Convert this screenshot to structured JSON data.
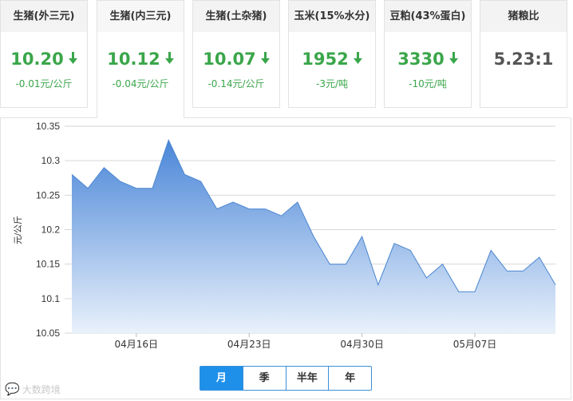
{
  "cards": [
    {
      "title": "生猪(外三元)",
      "price": "10.20",
      "change": "-0.01元/公斤",
      "trend": "down",
      "active": false
    },
    {
      "title": "生猪(内三元)",
      "price": "10.12",
      "change": "-0.04元/公斤",
      "trend": "down",
      "active": true
    },
    {
      "title": "生猪(土杂猪)",
      "price": "10.07",
      "change": "-0.14元/公斤",
      "trend": "down",
      "active": false
    },
    {
      "title": "玉米(15%水分)",
      "price": "1952",
      "change": "-3元/吨",
      "trend": "down",
      "active": false
    },
    {
      "title": "豆粕(43%蛋白)",
      "price": "3330",
      "change": "-10元/吨",
      "trend": "down",
      "active": false
    },
    {
      "title": "猪粮比",
      "price": "5.23:1",
      "change": "",
      "trend": "none",
      "active": false
    }
  ],
  "colors": {
    "down": "#3aa64a",
    "line": "#4a86cf",
    "area_top": "#4a86d8",
    "area_bottom": "#e9f1fb",
    "accent": "#1e90ea"
  },
  "chart_data": {
    "type": "area",
    "title": "",
    "xlabel": "",
    "ylabel": "元/公斤",
    "ylim": [
      10.05,
      10.35
    ],
    "yticks": [
      10.05,
      10.1,
      10.15,
      10.2,
      10.25,
      10.3,
      10.35
    ],
    "ytick_labels": [
      "10.05",
      "10.1",
      "10.15",
      "10.2",
      "10.25",
      "10.3",
      "10.35"
    ],
    "x": [
      "04-12",
      "04-13",
      "04-14",
      "04-15",
      "04-16",
      "04-17",
      "04-18",
      "04-19",
      "04-20",
      "04-21",
      "04-22",
      "04-23",
      "04-24",
      "04-25",
      "04-26",
      "04-27",
      "04-28",
      "04-29",
      "04-30",
      "05-01",
      "05-02",
      "05-03",
      "05-04",
      "05-05",
      "05-06",
      "05-07",
      "05-08",
      "05-09",
      "05-10",
      "05-11",
      "05-12"
    ],
    "xtick_labels": [
      {
        "date": "04-16",
        "label": "04月16日"
      },
      {
        "date": "04-23",
        "label": "04月23日"
      },
      {
        "date": "04-30",
        "label": "04月30日"
      },
      {
        "date": "05-07",
        "label": "05月07日"
      }
    ],
    "series": [
      {
        "values": [
          10.28,
          10.26,
          10.29,
          10.27,
          10.26,
          10.26,
          10.33,
          10.28,
          10.27,
          10.23,
          10.24,
          10.23,
          10.23,
          10.22,
          10.24,
          10.19,
          10.15,
          10.15,
          10.19,
          10.12,
          10.18,
          10.17,
          10.13,
          10.15,
          10.11,
          10.11,
          10.17,
          10.14,
          10.14,
          10.16,
          10.12
        ]
      }
    ],
    "grid": true,
    "legend": "none"
  },
  "periods": {
    "buttons": [
      "月",
      "季",
      "半年",
      "年"
    ],
    "active_index": 0
  },
  "watermark": "大数跨境"
}
